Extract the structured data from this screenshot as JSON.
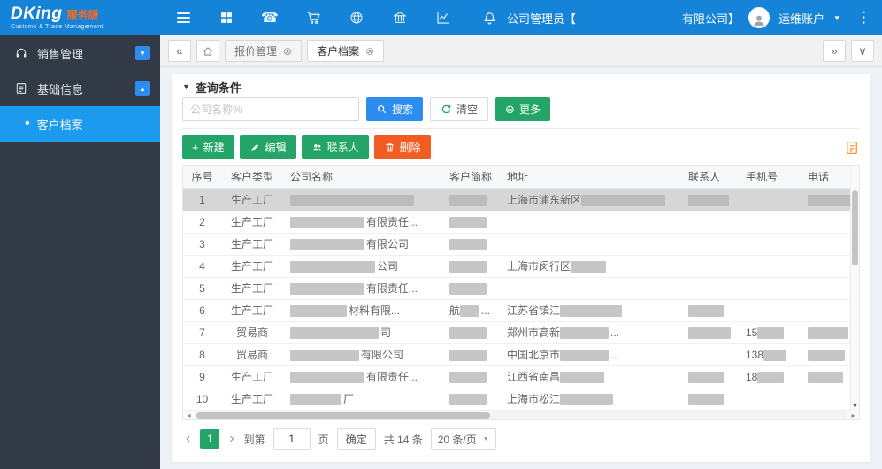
{
  "topbar": {
    "logo": "DKing",
    "edition": "服务版",
    "tagline": "Customs & Trade Management",
    "admin_prefix": "公司管理员【",
    "admin_suffix": "有限公司】",
    "account": "运维账户"
  },
  "icons": {
    "phone": "☎",
    "dots": "⋮",
    "caret_down": "▼",
    "caret_up": "▲",
    "scroll_left": "«",
    "scroll_right": "»",
    "tab_caret": "∨",
    "close": "⊗",
    "plus": "+",
    "plus_circle": "⊕",
    "prev": "‹",
    "next": "›",
    "left_small": "◂",
    "right_small": "▸",
    "down_small": "▼",
    "bullet": "•"
  },
  "sidebar": {
    "items": [
      {
        "label": "销售管理"
      },
      {
        "label": "基础信息",
        "children": [
          {
            "label": "客户档案",
            "active": true
          }
        ]
      }
    ]
  },
  "tabs": [
    {
      "label": "报价管理"
    },
    {
      "label": "客户档案",
      "active": true
    }
  ],
  "query": {
    "title": "查询条件",
    "placeholder": "公司名称%",
    "search": "搜索",
    "clear": "清空",
    "more": "更多"
  },
  "toolbar": {
    "new": "新建",
    "edit": "编辑",
    "contacts": "联系人",
    "delete": "删除"
  },
  "table": {
    "columns": [
      "序号",
      "客户类型",
      "公司名称",
      "客户简称",
      "地址",
      "联系人",
      "手机号",
      "电话"
    ],
    "rows": [
      {
        "no": "1",
        "type": "生产工厂",
        "selected": true,
        "cells": {
          "company": [
            {
              "r": 140
            }
          ],
          "short": [
            {
              "r": 42
            }
          ],
          "address": [
            {
              "t": "上海市浦东新区"
            },
            {
              "r": 95
            }
          ],
          "contact": [
            {
              "r": 46
            }
          ],
          "mobile": [],
          "phone": [
            {
              "r": 52
            }
          ]
        }
      },
      {
        "no": "2",
        "type": "生产工厂",
        "cells": {
          "company": [
            {
              "r": 84
            },
            {
              "t": "有限责任..."
            }
          ],
          "short": [
            {
              "r": 42
            }
          ]
        }
      },
      {
        "no": "3",
        "type": "生产工厂",
        "cells": {
          "company": [
            {
              "r": 84
            },
            {
              "t": "有限公司"
            }
          ],
          "short": [
            {
              "r": 42
            }
          ]
        }
      },
      {
        "no": "4",
        "type": "生产工厂",
        "cells": {
          "company": [
            {
              "r": 96
            },
            {
              "t": "公司"
            }
          ],
          "short": [
            {
              "r": 42
            }
          ],
          "address": [
            {
              "t": "上海市闵行区"
            },
            {
              "r": 40
            }
          ]
        }
      },
      {
        "no": "5",
        "type": "生产工厂",
        "cells": {
          "company": [
            {
              "r": 84
            },
            {
              "t": "有限责任..."
            }
          ],
          "short": [
            {
              "r": 42
            }
          ]
        }
      },
      {
        "no": "6",
        "type": "生产工厂",
        "cells": {
          "company": [
            {
              "r": 64
            },
            {
              "t": "材料有限..."
            }
          ],
          "short": [
            {
              "t": "航"
            },
            {
              "r": 22
            },
            {
              "t": "..."
            }
          ],
          "address": [
            {
              "t": "江苏省镇江"
            },
            {
              "r": 70
            }
          ],
          "contact": [
            {
              "r": 40
            }
          ]
        }
      },
      {
        "no": "7",
        "type": "贸易商",
        "cells": {
          "company": [
            {
              "r": 100
            },
            {
              "t": "司"
            }
          ],
          "short": [
            {
              "r": 42
            }
          ],
          "address": [
            {
              "t": "郑州市高新"
            },
            {
              "r": 55
            },
            {
              "t": "..."
            }
          ],
          "contact": [
            {
              "r": 48
            }
          ],
          "mobile": [
            {
              "t": "15"
            },
            {
              "r": 30
            }
          ],
          "phone": [
            {
              "r": 46
            }
          ]
        }
      },
      {
        "no": "8",
        "type": "贸易商",
        "cells": {
          "company": [
            {
              "r": 78
            },
            {
              "t": "有限公司"
            }
          ],
          "short": [
            {
              "r": 42
            }
          ],
          "address": [
            {
              "t": "中国北京市"
            },
            {
              "r": 55
            },
            {
              "t": "..."
            }
          ],
          "mobile": [
            {
              "t": "138"
            },
            {
              "r": 26
            }
          ],
          "phone": [
            {
              "r": 42
            }
          ]
        }
      },
      {
        "no": "9",
        "type": "生产工厂",
        "cells": {
          "company": [
            {
              "r": 84
            },
            {
              "t": "有限责任..."
            }
          ],
          "short": [
            {
              "r": 42
            }
          ],
          "address": [
            {
              "t": "江西省南昌"
            },
            {
              "r": 50
            }
          ],
          "contact": [
            {
              "r": 40
            }
          ],
          "mobile": [
            {
              "t": "18"
            },
            {
              "r": 30
            }
          ],
          "phone": [
            {
              "r": 40
            }
          ]
        }
      },
      {
        "no": "10",
        "type": "生产工厂",
        "cells": {
          "company": [
            {
              "r": 58
            },
            {
              "t": "厂"
            }
          ],
          "short": [
            {
              "r": 42
            }
          ],
          "address": [
            {
              "t": "上海市松江"
            },
            {
              "r": 60
            }
          ],
          "contact": [
            {
              "r": 40
            }
          ]
        }
      }
    ]
  },
  "pagination": {
    "page": "1",
    "goto_label": "到第",
    "goto_value": "1",
    "page_label": "页",
    "confirm": "确定",
    "total": "共 14 条",
    "page_size": "20 条/页"
  }
}
